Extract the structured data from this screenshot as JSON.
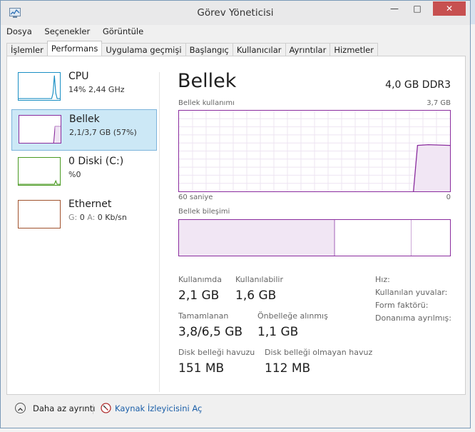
{
  "window": {
    "title": "Görev Yöneticisi",
    "minimize": "—",
    "maximize": "□",
    "close": "✕"
  },
  "menu": [
    "Dosya",
    "Seçenekler",
    "Görüntüle"
  ],
  "tabs": [
    "İşlemler",
    "Performans",
    "Uygulama geçmişi",
    "Başlangıç",
    "Kullanıcılar",
    "Ayrıntılar",
    "Hizmetler"
  ],
  "active_tab": "Performans",
  "sidebar": [
    {
      "name": "CPU",
      "sub": "14% 2,44 GHz",
      "color": "#1a8fc4"
    },
    {
      "name": "Bellek",
      "sub": "2,1/3,7 GB (57%)",
      "color": "#8a2c9e"
    },
    {
      "name": "0 Diski (C:)",
      "sub": "%0",
      "color": "#4a9a22"
    },
    {
      "name": "Ethernet",
      "sub_g_label": "G:",
      "sub_g": "0",
      "sub_a_label": "A:",
      "sub_a": "0 Kb/sn",
      "color": "#a0522d"
    }
  ],
  "main": {
    "title": "Bellek",
    "spec": "4,0 GB DDR3",
    "usage_label": "Bellek kullanımı",
    "usage_max": "3,7 GB",
    "time_left": "60 saniye",
    "time_right": "0",
    "usage_level_recent": 0.57,
    "composition_label": "Bellek bileşimi",
    "composition_in_use_fraction": 0.57
  },
  "stats": {
    "in_use_label": "Kullanımda",
    "in_use": "2,1 GB",
    "available_label": "Kullanılabilir",
    "available": "1,6 GB",
    "committed_label": "Tamamlanan",
    "committed": "3,8/6,5 GB",
    "cached_label": "Önbelleğe alınmış",
    "cached": "1,1 GB",
    "paged_label": "Disk belleği havuzu",
    "paged": "151 MB",
    "nonpaged_label": "Disk belleği olmayan havuz",
    "nonpaged": "112 MB"
  },
  "right_labels": [
    "Hız:",
    "Kullanılan yuvalar:",
    "Form faktörü:",
    "Donanıma ayrılmış:"
  ],
  "footer": {
    "fewer_details": "Daha az ayrıntı",
    "resource_monitor": "Kaynak İzleyicisini Aç"
  }
}
